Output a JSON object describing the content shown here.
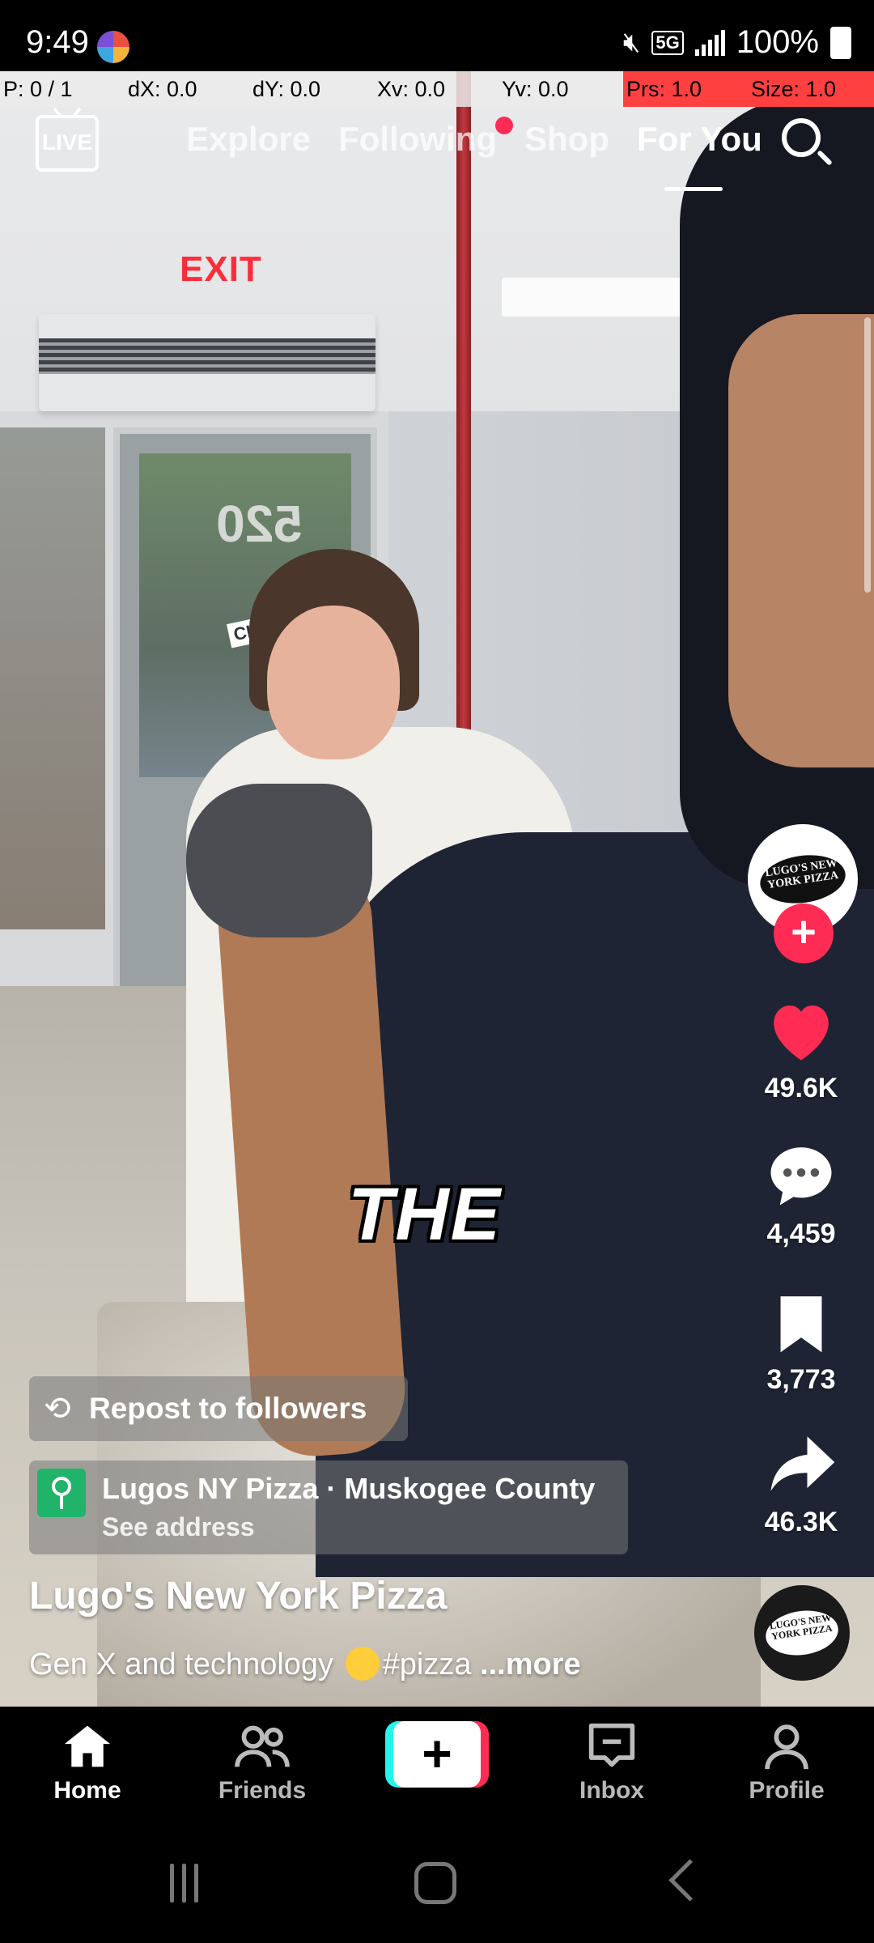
{
  "status_bar": {
    "time": "9:49",
    "network": "5G",
    "battery": "100%"
  },
  "debug_overlay": {
    "p": "P: 0 / 1",
    "dx": "dX: 0.0",
    "dy": "dY: 0.0",
    "xv": "Xv: 0.0",
    "yv": "Yv: 0.0",
    "prs": "Prs: 1.0",
    "size": "Size: 1.0"
  },
  "top_nav": {
    "live_label": "LIVE",
    "tabs": [
      {
        "label": "Explore"
      },
      {
        "label": "Following"
      },
      {
        "label": "Shop"
      },
      {
        "label": "For You"
      }
    ],
    "active_tab": "For You"
  },
  "video": {
    "caption_word": "THE",
    "sign_text": "EXIT",
    "door_number": "520",
    "door_sign": "CLOSED"
  },
  "actions": {
    "avatar_logo": "LUGO'S NEW YORK PIZZA",
    "likes": "49.6K",
    "comments": "4,459",
    "bookmarks": "3,773",
    "shares": "46.3K"
  },
  "post": {
    "repost_label": "Repost to followers",
    "location_title": "Lugos NY Pizza · Muskogee County",
    "location_sub": "See address",
    "author": "Lugo's New York Pizza",
    "description": "Gen X and technology",
    "hashtag": "#pizza",
    "more": "...more"
  },
  "tab_bar": {
    "home": "Home",
    "friends": "Friends",
    "create": "+",
    "inbox": "Inbox",
    "profile": "Profile"
  },
  "colors": {
    "accent": "#fe2c55",
    "create_cyan": "#25f4ee",
    "location_green": "#20b36a"
  }
}
